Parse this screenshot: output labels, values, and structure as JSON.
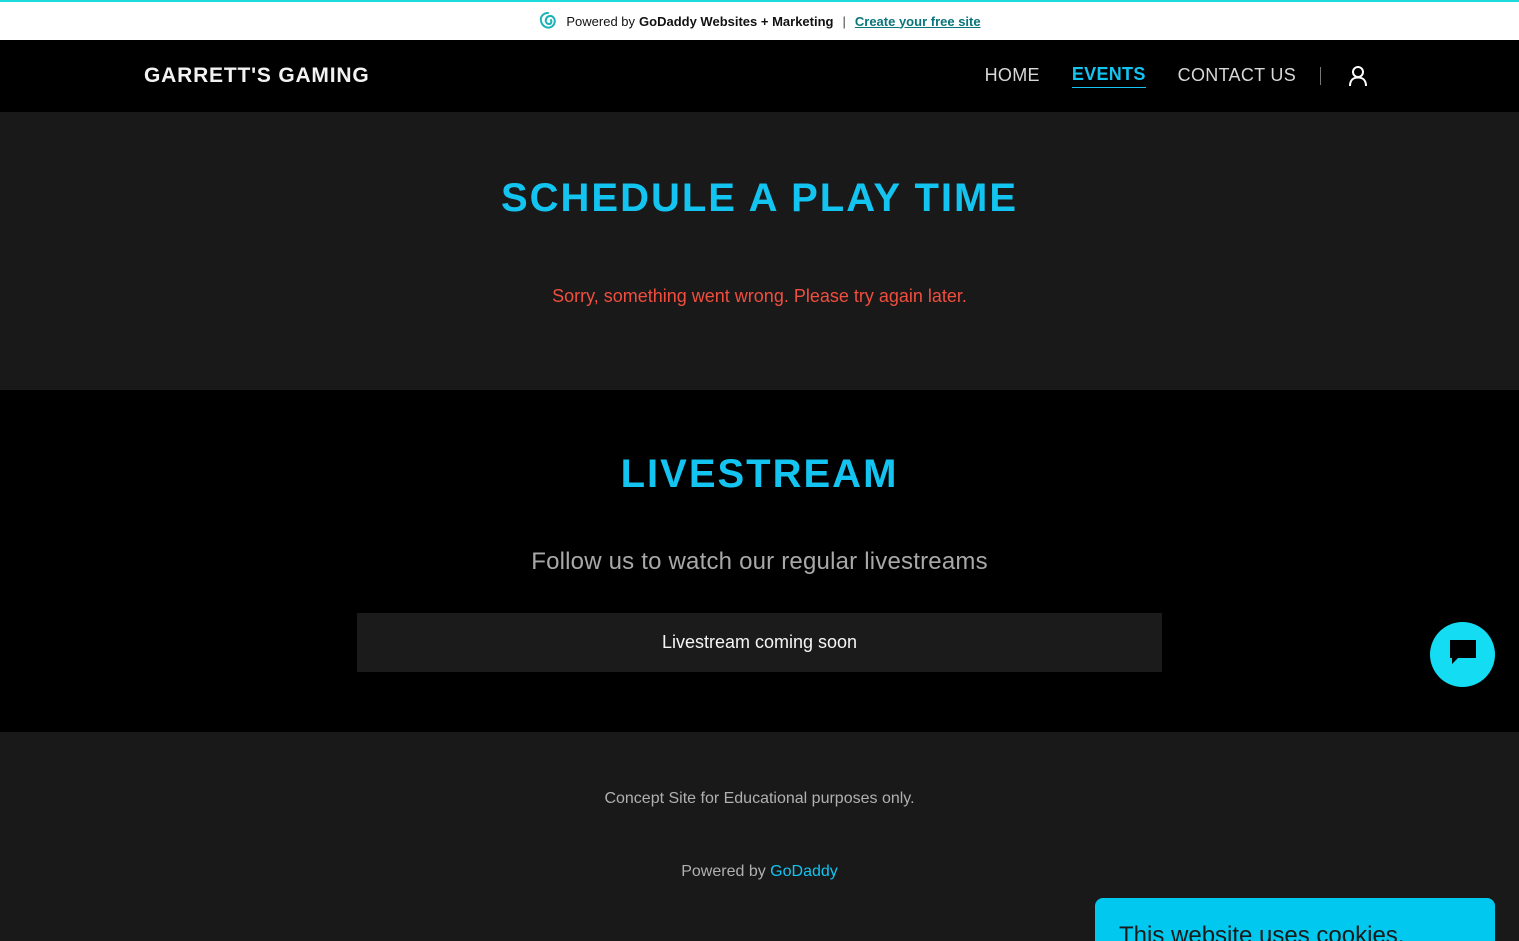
{
  "banner": {
    "powered_by": "Powered by",
    "brand": "GoDaddy Websites + Marketing",
    "separator": "|",
    "create_link": "Create your free site",
    "logo_icon": "godaddy-logo-icon",
    "accent_color": "#1bdbdb"
  },
  "header": {
    "site_title": "GARRETT'S GAMING",
    "nav": [
      {
        "label": "HOME",
        "active": false
      },
      {
        "label": "EVENTS",
        "active": true
      },
      {
        "label": "CONTACT US",
        "active": false
      }
    ],
    "account_icon": "user-account-icon",
    "active_color": "#13c4f0"
  },
  "schedule": {
    "heading": "SCHEDULE A PLAY TIME",
    "error": "Sorry, something went wrong. Please try again later.",
    "error_color": "#f04e3e"
  },
  "livestream": {
    "heading": "LIVESTREAM",
    "subtitle": "Follow us to watch our regular livestreams",
    "placeholder": "Livestream coming soon"
  },
  "footer": {
    "note": "Concept Site for Educational purposes only.",
    "powered_prefix": "Powered by",
    "powered_link": "GoDaddy"
  },
  "chat": {
    "icon": "chat-bubble-icon",
    "color": "#13dcf3"
  },
  "cookie": {
    "text": "This website uses cookies."
  }
}
